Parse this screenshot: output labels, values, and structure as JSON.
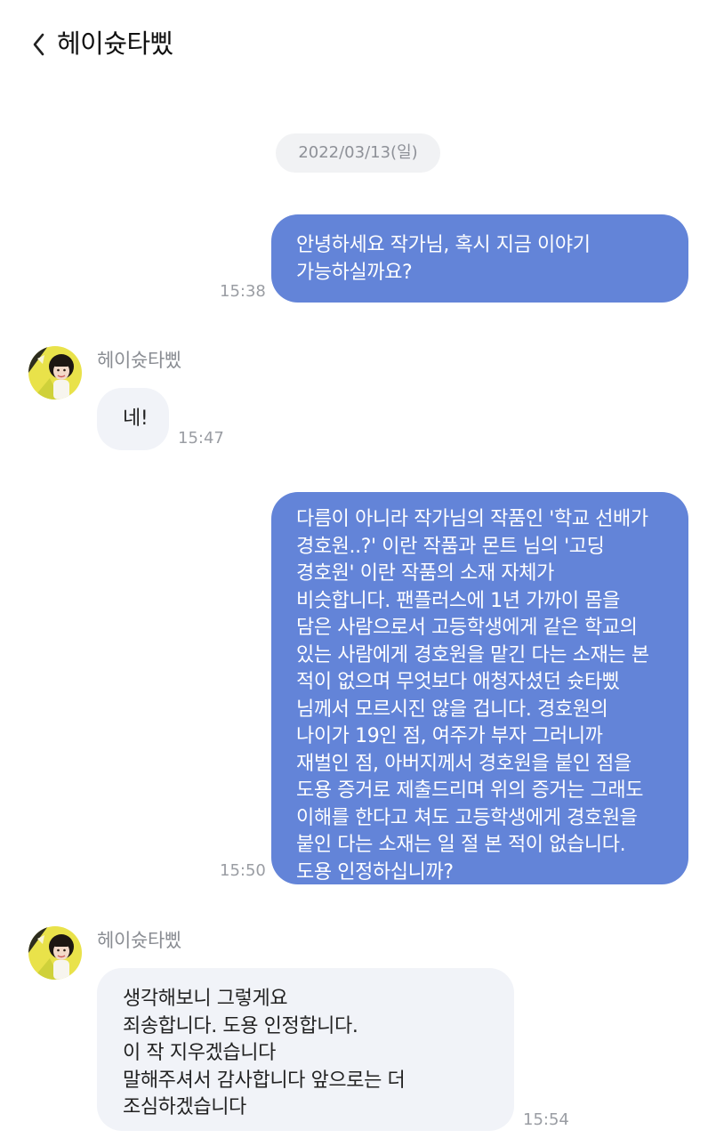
{
  "header": {
    "title": "헤이슛타삤"
  },
  "date_divider": "2022/03/13(일)",
  "messages": [
    {
      "direction": "out",
      "text": "안녕하세요 작가님, 혹시 지금 이야기\n가능하실까요?",
      "time": "15:38"
    },
    {
      "direction": "in",
      "sender": "헤이슛타삤",
      "text": "네!",
      "time": "15:47"
    },
    {
      "direction": "out",
      "text": "다름이 아니라 작가님의 작품인 '학교 선배가\n경호원..?' 이란 작품과 몬트 님의 '고딩\n경호원' 이란 작품의 소재 자체가\n비슷합니다. 팬플러스에 1년 가까이 몸을\n담은 사람으로서 고등학생에게 같은 학교의\n있는 사람에게 경호원을 맡긴 다는 소재는 본\n적이 없으며 무엇보다 애청자셨던 슛타삤\n님께서 모르시진 않을 겁니다. 경호원의\n나이가 19인 점, 여주가 부자 그러니까\n재벌인 점, 아버지께서 경호원을 붙인 점을\n도용 증거로 제출드리며 위의 증거는 그래도\n이해를 한다고 쳐도 고등학생에게 경호원을\n붙인 다는 소재는 일 절 본 적이 없습니다.\n도용 인정하십니까?",
      "time": "15:50"
    },
    {
      "direction": "in",
      "sender": "헤이슛타삤",
      "text": "생각해보니 그렇게요\n죄송합니다. 도용 인정합니다.\n이 작 지우겠습니다\n말해주셔서 감사합니다 앞으로는 더\n조심하겠습니다",
      "time": "15:54"
    }
  ],
  "colors": {
    "outgoing_bubble": "#6384d8",
    "incoming_bubble": "#f1f3f8",
    "date_pill": "#f1f2f4",
    "time_text": "#9a9da3"
  },
  "icons": {
    "back": "chevron-left-icon",
    "avatar": "profile-avatar"
  }
}
